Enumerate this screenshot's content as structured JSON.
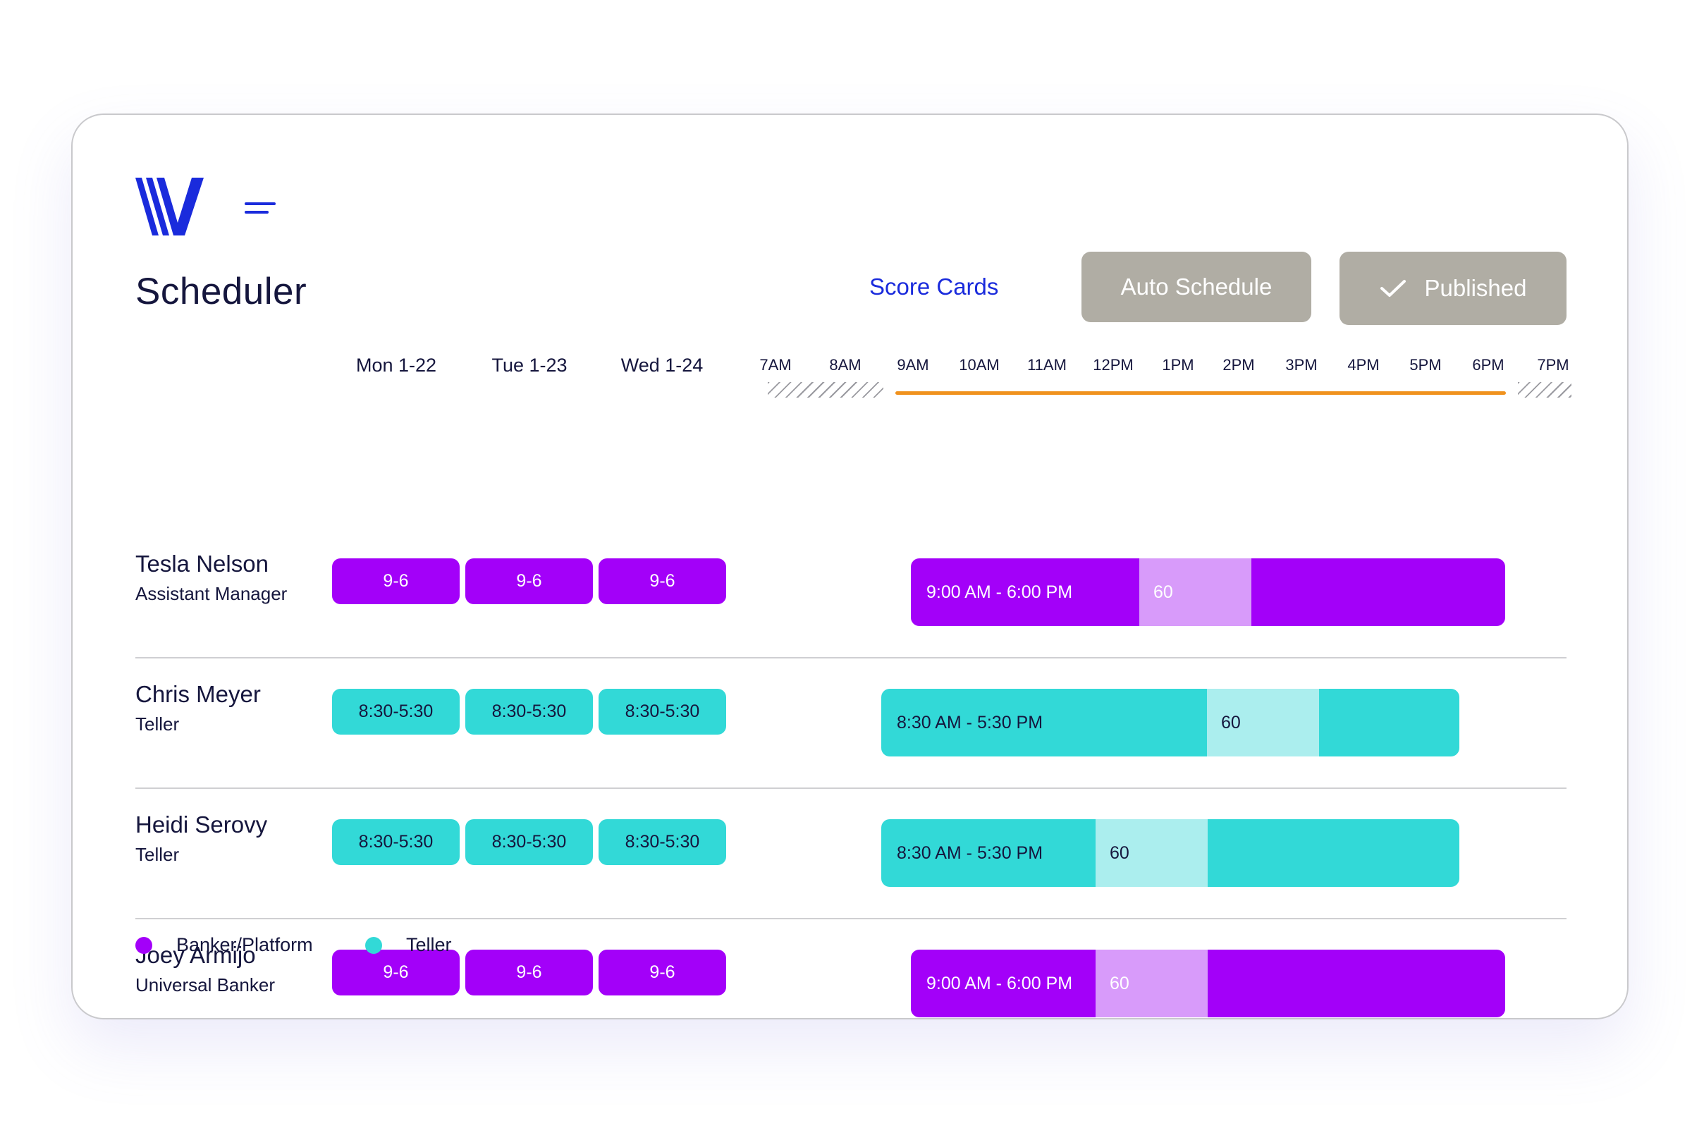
{
  "app": {
    "title": "Scheduler",
    "logo_icon": "v-logo-icon",
    "menu_icon": "hamburger-menu-icon"
  },
  "header": {
    "score_cards_label": "Score Cards",
    "auto_schedule_label": "Auto Schedule",
    "published_label": "Published",
    "published_icon": "check-icon"
  },
  "days": [
    "Mon 1-22",
    "Tue 1-23",
    "Wed 1-24"
  ],
  "hours": [
    "7AM",
    "8AM",
    "9AM",
    "10AM",
    "11AM",
    "12PM",
    "1PM",
    "2PM",
    "3PM",
    "4PM",
    "5PM",
    "6PM",
    "7PM"
  ],
  "employees": [
    {
      "name": "Tesla Nelson",
      "role": "Assistant Manager",
      "type": "banker",
      "day_shifts": [
        "9-6",
        "9-6",
        "9-6"
      ],
      "timeline_label": "9:00 AM - 6:00 PM",
      "break_label": "60"
    },
    {
      "name": "Chris Meyer",
      "role": "Teller",
      "type": "teller",
      "day_shifts": [
        "8:30-5:30",
        "8:30-5:30",
        "8:30-5:30"
      ],
      "timeline_label": "8:30 AM - 5:30 PM",
      "break_label": "60"
    },
    {
      "name": "Heidi Serovy",
      "role": "Teller",
      "type": "teller",
      "day_shifts": [
        "8:30-5:30",
        "8:30-5:30",
        "8:30-5:30"
      ],
      "timeline_label": "8:30 AM - 5:30 PM",
      "break_label": "60"
    },
    {
      "name": "Joey Armijo",
      "role": "Universal Banker",
      "type": "banker",
      "day_shifts": [
        "9-6",
        "9-6",
        "9-6"
      ],
      "timeline_label": "9:00 AM - 6:00 PM",
      "break_label": "60"
    }
  ],
  "legend": [
    {
      "label": "Banker/Platform",
      "color": "#a300f9"
    },
    {
      "label": "Teller",
      "color": "#32d9d7"
    }
  ],
  "colors": {
    "brand": "#1a2bdc",
    "banker": "#a300f9",
    "banker_break": "#d89bfa",
    "teller": "#32d9d7",
    "teller_break": "#abeeee",
    "business_hours": "#f0921e",
    "button_gray": "#b0ada4"
  }
}
